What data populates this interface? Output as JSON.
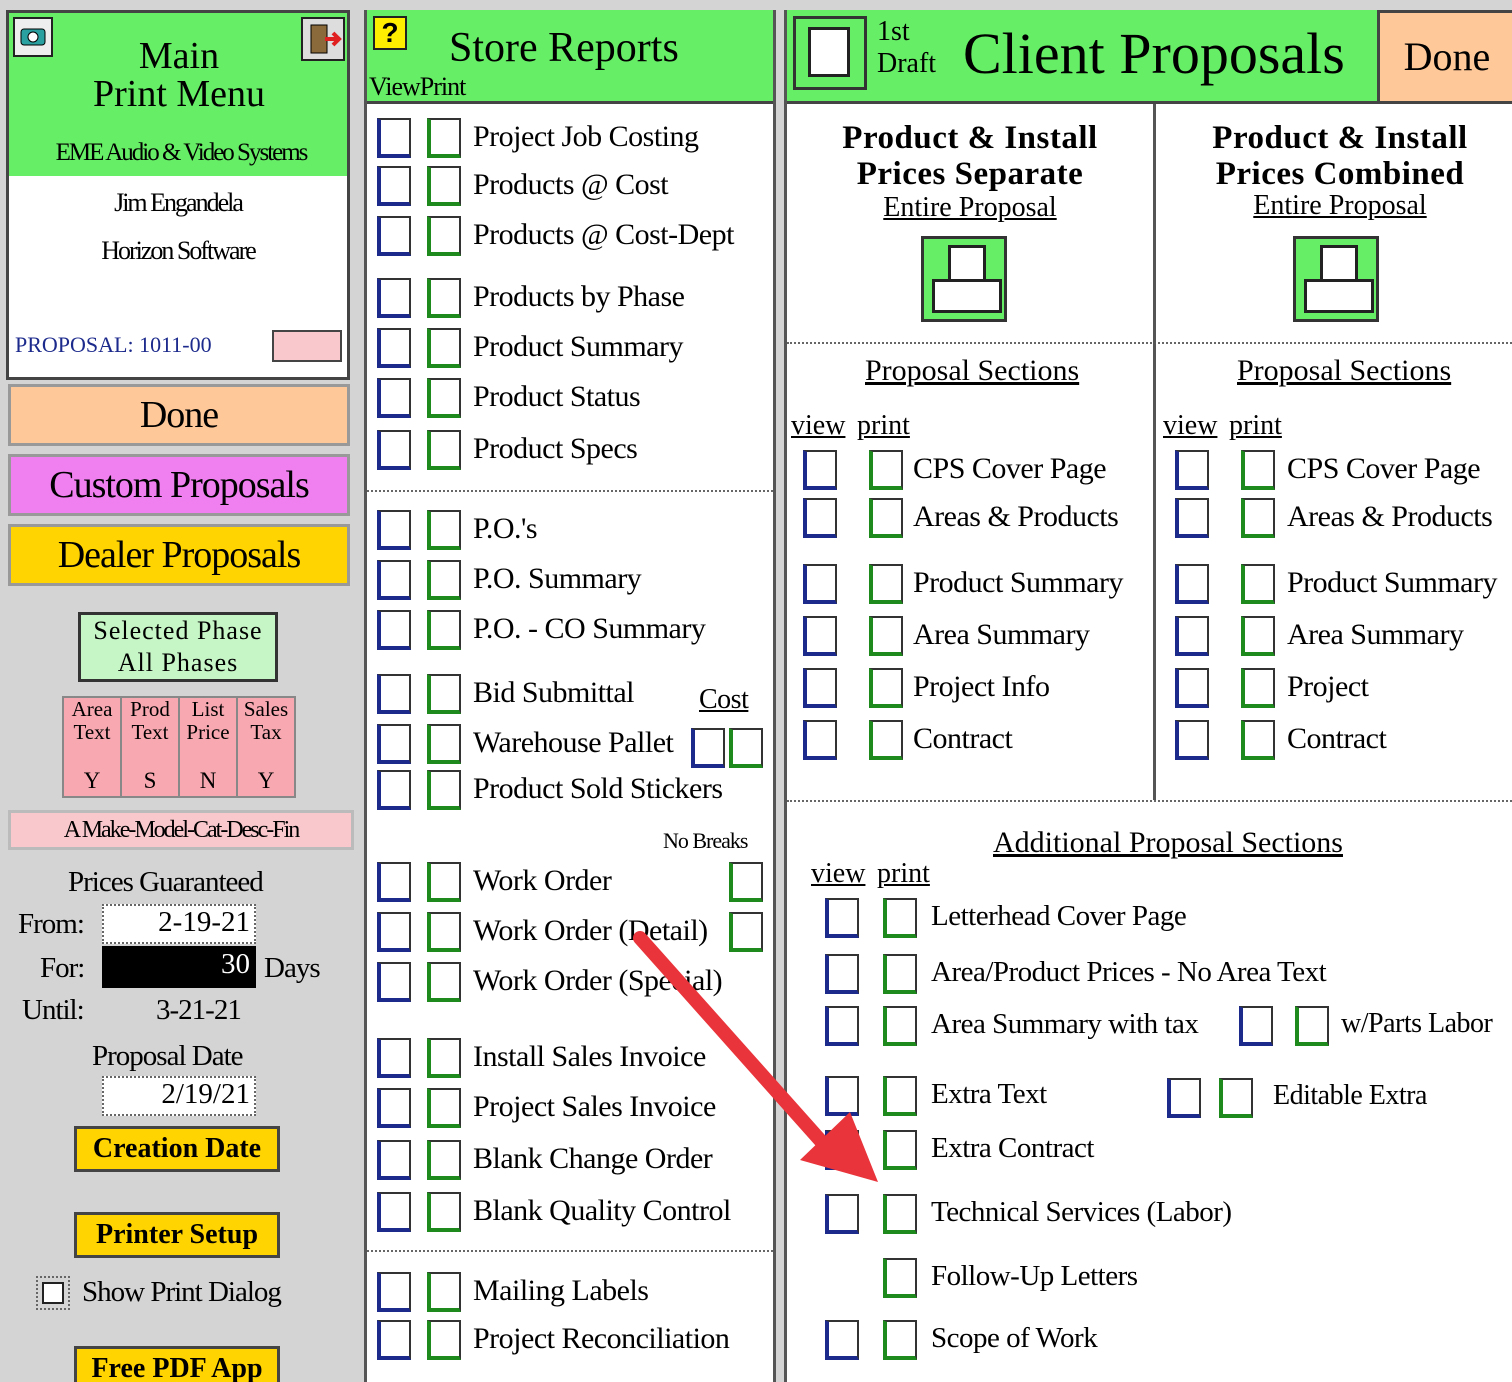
{
  "left": {
    "title": "Main\nPrint Menu",
    "company": "EME Audio & Video Systems",
    "user_name": "Jim Engandela",
    "software": "Horizon Software",
    "proposal_label": "PROPOSAL: 1011-00",
    "done_label": "Done",
    "custom_label": "Custom Proposals",
    "dealer_label": "Dealer Proposals",
    "phase_line1": "Selected Phase",
    "phase_line2": "All Phases",
    "flags": [
      {
        "l1": "Area",
        "l2": "Text",
        "v": "Y"
      },
      {
        "l1": "Prod",
        "l2": "Text",
        "v": "S"
      },
      {
        "l1": "List",
        "l2": "Price",
        "v": "N"
      },
      {
        "l1": "Sales",
        "l2": "Tax",
        "v": "Y"
      }
    ],
    "sort_label": "A Make-Model-Cat-Desc-Fin",
    "prices_guaranteed": "Prices Guaranteed",
    "from_label": "From:",
    "from_value": "2-19-21",
    "for_label": "For:",
    "for_value": "30",
    "days_label": "Days",
    "until_label": "Until:",
    "until_value": "3-21-21",
    "proposal_date_label": "Proposal Date",
    "proposal_date_value": "2/19/21",
    "creation_date_label": "Creation Date",
    "printer_setup_label": "Printer Setup",
    "show_print_dialog": "Show Print Dialog",
    "free_pdf_label": "Free PDF App",
    "colors": {
      "green": "#66ee66",
      "done": "#ffc898",
      "custom": "#f080f0",
      "dealer": "#ffd400",
      "pink": "#f8c8cc"
    }
  },
  "store": {
    "title": "Store Reports",
    "view_print": "ViewPrint",
    "items": [
      "Project Job Costing",
      "Products @ Cost",
      "Products @ Cost-Dept",
      "Products by Phase",
      "Product Summary",
      "Product Status",
      "Product Specs",
      "P.O.'s",
      "P.O. Summary",
      "P.O. - CO Summary",
      "Bid Submittal",
      "Warehouse Pallet",
      "Product Sold Stickers",
      "Work Order",
      "Work Order (Detail)",
      "Work Order (Special)",
      "Install Sales Invoice",
      "Project Sales Invoice",
      "Blank Change Order",
      "Blank Quality Control",
      "Mailing Labels",
      "Project Reconciliation"
    ],
    "cost_label": "Cost",
    "no_breaks_label": "No Breaks"
  },
  "client": {
    "draft_line1": "1st",
    "draft_line2": "Draft",
    "title": "Client Proposals",
    "done_label": "Done",
    "separate": {
      "line1": "Product & Install",
      "line2": "Prices Separate",
      "link": "Entire Proposal"
    },
    "combined": {
      "line1": "Product & Install",
      "line2": "Prices Combined",
      "link": "Entire Proposal"
    },
    "sections_title": "Proposal Sections",
    "view_label": "view",
    "print_label": "print",
    "left_sections": [
      "CPS Cover Page",
      "Areas & Products",
      "Product Summary",
      "Area Summary",
      "Project Info",
      "Contract"
    ],
    "right_sections": [
      "CPS Cover Page",
      "Areas & Products",
      "Product Summary",
      "Area Summary",
      "Project",
      "Contract"
    ],
    "additional_title": "Additional Proposal Sections",
    "additional": [
      "Letterhead Cover Page",
      "Area/Product Prices - No Area Text",
      "Area Summary with tax",
      "Extra Text",
      "Extra Contract",
      "Technical Services (Labor)",
      "Follow-Up Letters",
      "Scope of Work"
    ],
    "parts_labor_label": "w/Parts Labor",
    "editable_extra_label": "Editable Extra",
    "annotation_arrow_color": "#e8343a"
  }
}
